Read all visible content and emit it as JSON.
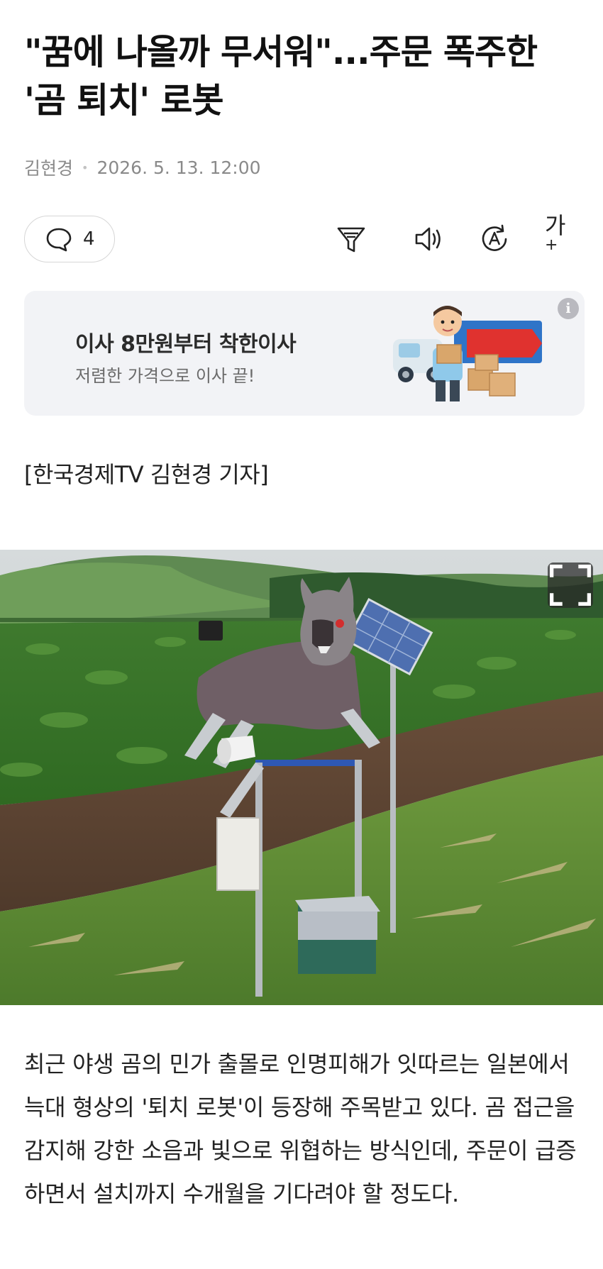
{
  "article": {
    "headline": "\"꿈에 나올까 무서워\"...주문 폭주한 '곰 퇴치' 로봇",
    "author": "김현경",
    "date": "2026. 5. 13. 12:00",
    "reporter_credit": "[한국경제TV 김현경 기자]",
    "body": "최근 야생 곰의 민가 출몰로 인명피해가 잇따르는 일본에서 늑대 형상의 '퇴치 로봇'이 등장해 주목받고 있다. 곰 접근을 감지해 강한 소음과 빛으로 위협하는 방식인데, 주문이 급증하면서 설치까지 수개월을 기다려야 할 정도다."
  },
  "toolbar": {
    "comment_count": "4",
    "font_size_label": "가",
    "font_size_plus": "+",
    "icons": [
      "comment-icon",
      "summary-filter-icon",
      "audio-speaker-icon",
      "translate-icon",
      "font-size-icon"
    ]
  },
  "ad": {
    "title": "이사 8만원부터 착한이사",
    "subtitle": "저렴한 가격으로 이사 끝!",
    "info_glyph": "i"
  },
  "photo": {
    "expand_icon": "fullscreen-expand-icon"
  },
  "colors": {
    "text_primary": "#111111",
    "text_meta": "#8a8a8a",
    "ad_background": "#f2f3f6"
  }
}
